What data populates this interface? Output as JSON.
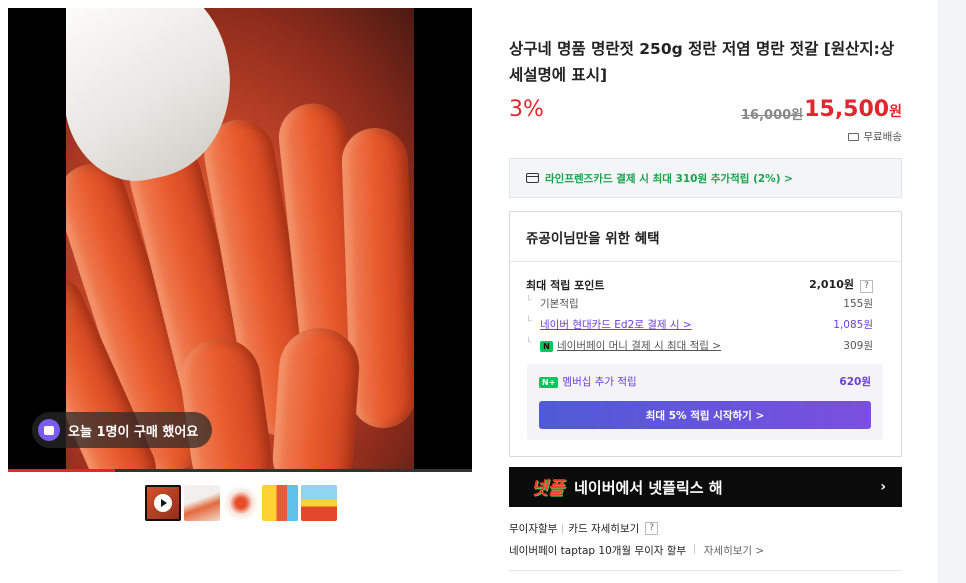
{
  "media": {
    "buy_badge": "오늘 1명이 구매 했어요",
    "progress_fraction": 0.23,
    "thumbnail_count": 5
  },
  "product": {
    "title": "상구네 명품 명란젓 250g 정란 저염 명란 젓갈 [원산지:상세설명에 표시]",
    "discount": "3%",
    "original_price": "16,000원",
    "sale_price": "15,500",
    "sale_unit": "원",
    "shipping": "무료배송"
  },
  "card_promo": "라인프렌즈카드 결제 시 최대 310원 추가적립 (2%) >",
  "benefit": {
    "heading": "쥬공이님만을 위한 혜택",
    "max_label": "최대 적립 포인트",
    "max_value": "2,010원",
    "help": "?",
    "rows": [
      {
        "label": "기본적립",
        "value": "155원"
      },
      {
        "label": "네이버 현대카드 Ed2로 결제 시 >",
        "value": "1,085원"
      },
      {
        "label": "네이버페이 머니 결제 시 최대 적립 >",
        "value": "309원"
      }
    ],
    "npay_badge": "N",
    "membership": {
      "badge": "N+",
      "label": "멤버십 추가 적립",
      "value": "620원",
      "button": "최대 5% 적립 시작하기 >"
    }
  },
  "banner": {
    "logo": "넷플",
    "text": "네이버에서 넷플릭스 해",
    "chevron": "›"
  },
  "installment": {
    "label1": "무이자할부",
    "label2": "카드 자세히보기",
    "help": "?",
    "line2_main": "네이버페이 taptap 10개월 무이자 할부",
    "line2_link": "자세히보기 >"
  },
  "colors": {
    "accent_red": "#e1262c",
    "purple": "#6a3fd6",
    "npay_green": "#03c75a"
  }
}
